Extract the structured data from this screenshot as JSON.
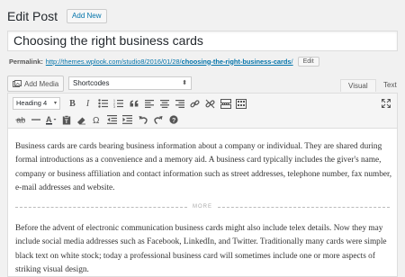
{
  "header": {
    "title": "Edit Post",
    "add_new": "Add New"
  },
  "post": {
    "title": "Choosing the right business cards"
  },
  "permalink": {
    "label": "Permalink:",
    "base": "http://themes.wplook.com/studio8/2016/01/28/",
    "slug": "choosing-the-right-business-cards",
    "trailing": "/",
    "edit_label": "Edit"
  },
  "media": {
    "add_media_label": "Add Media",
    "shortcodes_value": "Shortcodes"
  },
  "tabs": {
    "visual": "Visual",
    "text": "Text"
  },
  "toolbar": {
    "format_value": "Heading 4",
    "bold_label": "B",
    "italic_label": "I",
    "row1_icons": [
      "bullet-list-icon",
      "numbered-list-icon",
      "blockquote-icon",
      "align-left-icon",
      "align-center-icon",
      "align-right-icon",
      "insert-link-icon",
      "remove-link-icon",
      "read-more-icon",
      "toolbar-toggle-icon"
    ],
    "row2_icons": [
      "strikethrough-icon",
      "horizontal-line-icon",
      "text-color-icon",
      "paste-text-icon",
      "clear-formatting-icon",
      "special-character-icon",
      "outdent-icon",
      "indent-icon",
      "undo-icon",
      "redo-icon",
      "help-icon"
    ]
  },
  "content": {
    "paragraph1": "Business cards are cards bearing business information about a company or individual. They are shared during formal introductions as a convenience and a memory aid. A business card typically includes the giver's name, company or business affiliation and contact information such as street addresses, telephone number, fax number, e-mail addresses and website.",
    "more_label": "MORE",
    "paragraph2": "Before the advent of electronic communication business cards might also include telex details. Now they may include social media addresses such as Facebook, LinkedIn, and Twitter. Traditionally many cards were simple black text on white stock; today a professional business card will sometimes include one or more aspects of striking visual design."
  }
}
